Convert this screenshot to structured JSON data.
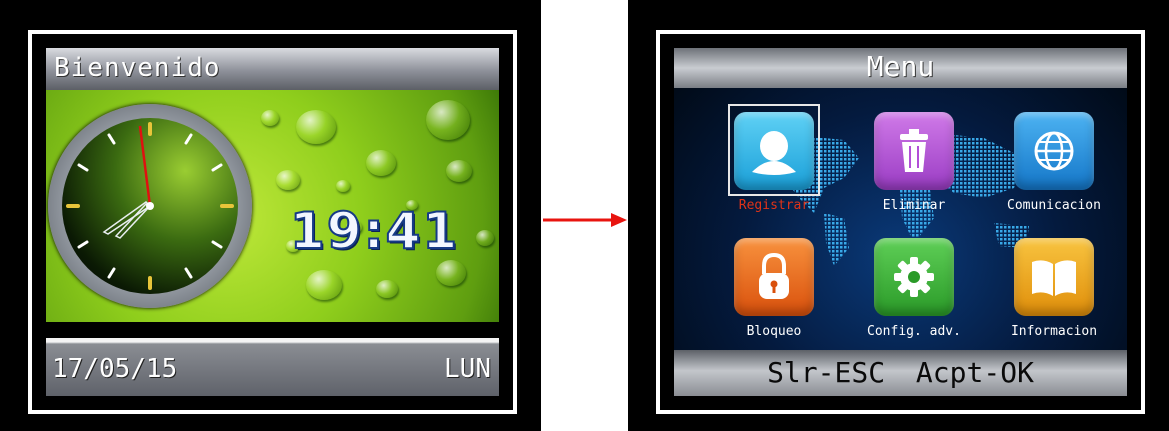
{
  "home_screen": {
    "greeting": "Bienvenido",
    "time": "19:41",
    "date": "17/05/15",
    "day": "LUN"
  },
  "menu_screen": {
    "title": "Menu",
    "items": [
      {
        "label": "Registrar",
        "icon": "user-icon",
        "color": "#2fb6ea",
        "selected": true
      },
      {
        "label": "Eliminar",
        "icon": "trash-icon",
        "color": "#b24fd8",
        "selected": false
      },
      {
        "label": "Comunicacion",
        "icon": "globe-icon",
        "color": "#1f8fe0",
        "selected": false
      },
      {
        "label": "Bloqueo",
        "icon": "lock-icon",
        "color": "#f06a1a",
        "selected": false
      },
      {
        "label": "Config. adv.",
        "icon": "gear-icon",
        "color": "#3db33a",
        "selected": false
      },
      {
        "label": "Informacion",
        "icon": "book-icon",
        "color": "#f2a816",
        "selected": false
      }
    ],
    "footer_hint": "Slr-ESC Acpt-OK"
  },
  "colors": {
    "arrow": "#e8140f",
    "selected_label": "#e03318"
  }
}
